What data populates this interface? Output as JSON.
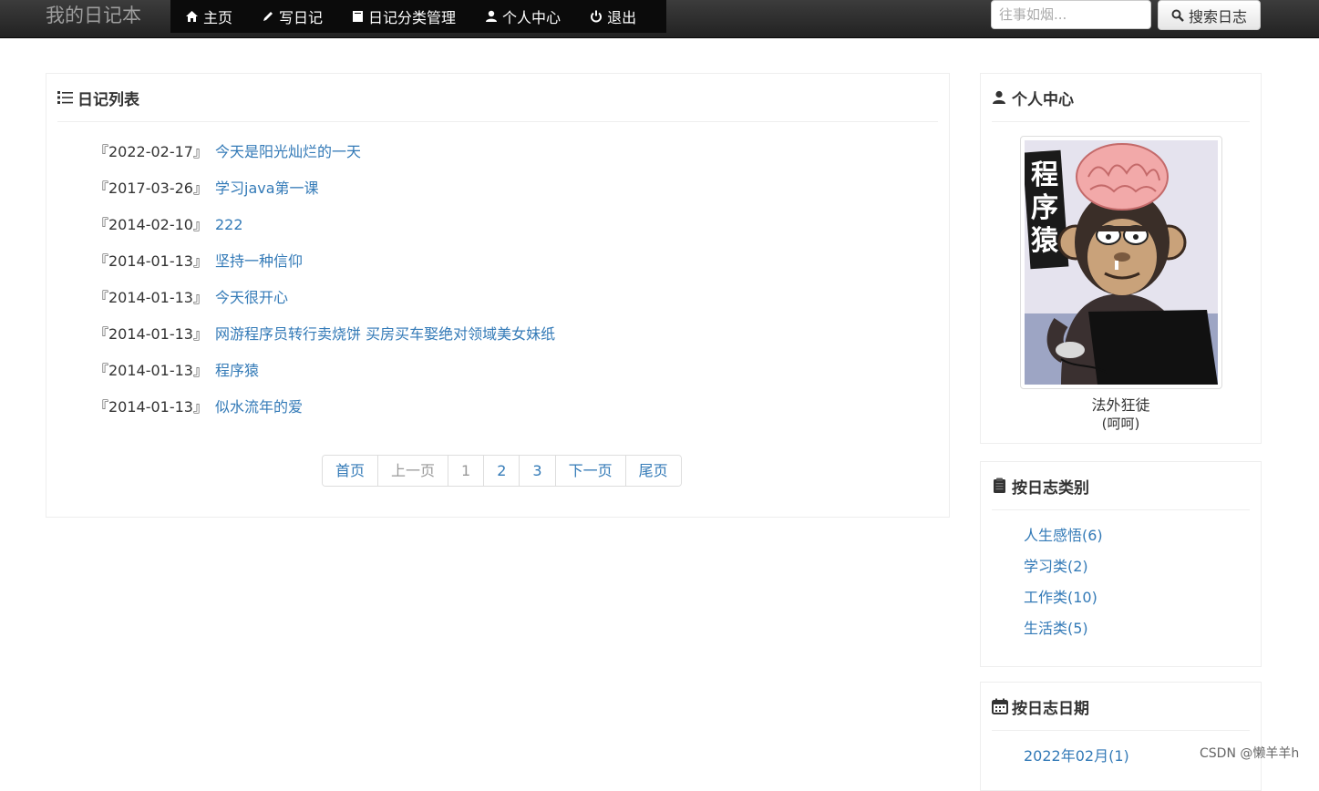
{
  "nav": {
    "brand": "我的日记本",
    "items": [
      {
        "label": "主页",
        "icon": "home-icon"
      },
      {
        "label": "写日记",
        "icon": "pencil-icon"
      },
      {
        "label": "日记分类管理",
        "icon": "book-icon"
      },
      {
        "label": "个人中心",
        "icon": "user-icon"
      },
      {
        "label": "退出",
        "icon": "power-icon"
      }
    ],
    "search": {
      "placeholder": "往事如烟...",
      "button_label": "搜索日志",
      "icon": "search-icon"
    }
  },
  "diary_list": {
    "title": "日记列表",
    "items": [
      {
        "date": "『2022-02-17』",
        "title": "今天是阳光灿烂的一天"
      },
      {
        "date": "『2017-03-26』",
        "title": "学习java第一课"
      },
      {
        "date": "『2014-02-10』",
        "title": "222"
      },
      {
        "date": "『2014-01-13』",
        "title": "坚持一种信仰"
      },
      {
        "date": "『2014-01-13』",
        "title": "今天很开心"
      },
      {
        "date": "『2014-01-13』",
        "title": "网游程序员转行卖烧饼 买房买车娶绝对领域美女妹纸"
      },
      {
        "date": "『2014-01-13』",
        "title": "程序猿"
      },
      {
        "date": "『2014-01-13』",
        "title": "似水流年的爱"
      }
    ],
    "pagination": [
      "首页",
      "上一页",
      "1",
      "2",
      "3",
      "下一页",
      "尾页"
    ]
  },
  "profile": {
    "title": "个人中心",
    "avatar_text": "程序猿",
    "nickname": "法外狂徒",
    "signature": "(呵呵)"
  },
  "categories": {
    "title": "按日志类别",
    "items": [
      "人生感悟(6)",
      "学习类(2)",
      "工作类(10)",
      "生活类(5)"
    ]
  },
  "dates": {
    "title": "按日志日期",
    "items": [
      "2022年02月(1)"
    ]
  },
  "watermark": "CSDN @懒羊羊h",
  "colors": {
    "link": "#337ab7",
    "navbar": "#222222",
    "border": "#eeeeee"
  }
}
